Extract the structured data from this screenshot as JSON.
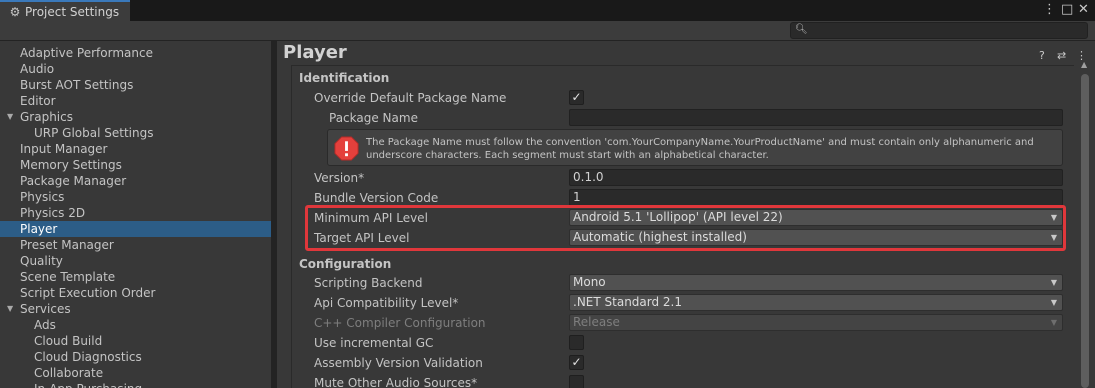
{
  "window": {
    "tab_title": "Project Settings",
    "tab_icon": "gear-icon",
    "menu_glyph": "⋮",
    "maximize_glyph": "□",
    "close_glyph": "✕"
  },
  "search": {
    "placeholder": "",
    "value": ""
  },
  "sidebar": {
    "items": [
      {
        "label": "Adaptive Performance"
      },
      {
        "label": "Audio"
      },
      {
        "label": "Burst AOT Settings"
      },
      {
        "label": "Editor"
      },
      {
        "label": "Graphics",
        "expanded": true
      },
      {
        "label": "URP Global Settings",
        "child": true
      },
      {
        "label": "Input Manager"
      },
      {
        "label": "Memory Settings"
      },
      {
        "label": "Package Manager"
      },
      {
        "label": "Physics"
      },
      {
        "label": "Physics 2D"
      },
      {
        "label": "Player",
        "selected": true
      },
      {
        "label": "Preset Manager"
      },
      {
        "label": "Quality"
      },
      {
        "label": "Scene Template"
      },
      {
        "label": "Script Execution Order"
      },
      {
        "label": "Services",
        "expanded": true
      },
      {
        "label": "Ads",
        "child": true
      },
      {
        "label": "Cloud Build",
        "child": true
      },
      {
        "label": "Cloud Diagnostics",
        "child": true
      },
      {
        "label": "Collaborate",
        "child": true
      },
      {
        "label": "In-App Purchasing",
        "child": true
      }
    ]
  },
  "main": {
    "title": "Player",
    "header_icons": {
      "help": "?",
      "preset": "⇄",
      "menu": "⋮"
    },
    "identification": {
      "title": "Identification",
      "override_package_name": {
        "label": "Override Default Package Name",
        "checked": true
      },
      "package_name": {
        "label": "Package Name",
        "value": ""
      },
      "warning": {
        "icon": "error-icon",
        "text": "The Package Name must follow the convention 'com.YourCompanyName.YourProductName' and must contain only alphanumeric and underscore characters. Each segment must start with an alphabetical character."
      },
      "version": {
        "label": "Version*",
        "value": "0.1.0"
      },
      "bundle_version_code": {
        "label": "Bundle Version Code",
        "value": "1"
      },
      "minimum_api_level": {
        "label": "Minimum API Level",
        "value": "Android 5.1 'Lollipop' (API level 22)"
      },
      "target_api_level": {
        "label": "Target API Level",
        "value": "Automatic (highest installed)"
      }
    },
    "configuration": {
      "title": "Configuration",
      "scripting_backend": {
        "label": "Scripting Backend",
        "value": "Mono"
      },
      "api_compatibility": {
        "label": "Api Compatibility Level*",
        "value": ".NET Standard 2.1"
      },
      "cpp_compiler": {
        "label": "C++ Compiler Configuration",
        "value": "Release",
        "disabled": true
      },
      "incremental_gc": {
        "label": "Use incremental GC",
        "checked": false
      },
      "assembly_validation": {
        "label": "Assembly Version Validation",
        "checked": true
      },
      "mute_audio": {
        "label": "Mute Other Audio Sources*",
        "checked": false
      }
    }
  },
  "colors": {
    "selection": "#2c5d87",
    "highlight": "#e0373b",
    "error": "#e4403c"
  }
}
